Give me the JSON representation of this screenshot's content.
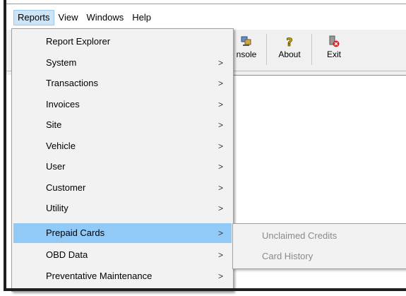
{
  "menubar": {
    "items": [
      {
        "label": "Reports",
        "active": true
      },
      {
        "label": "View",
        "active": false
      },
      {
        "label": "Windows",
        "active": false
      },
      {
        "label": "Help",
        "active": false
      }
    ]
  },
  "toolbar": {
    "buttons": [
      {
        "label": "nsole",
        "icon": "console-icon"
      },
      {
        "label": "About",
        "icon": "about-icon"
      },
      {
        "label": "Exit",
        "icon": "exit-icon"
      }
    ]
  },
  "reports_menu": {
    "items": [
      {
        "label": "Report Explorer",
        "has_submenu": false
      },
      {
        "label": "System",
        "has_submenu": true
      },
      {
        "label": "Transactions",
        "has_submenu": true
      },
      {
        "label": "Invoices",
        "has_submenu": true
      },
      {
        "label": "Site",
        "has_submenu": true
      },
      {
        "label": "Vehicle",
        "has_submenu": true
      },
      {
        "label": "User",
        "has_submenu": true
      },
      {
        "label": "Customer",
        "has_submenu": true
      },
      {
        "label": "Utility",
        "has_submenu": true
      },
      {
        "label": "Prepaid Cards",
        "has_submenu": true,
        "highlighted": true
      },
      {
        "label": "OBD Data",
        "has_submenu": true
      },
      {
        "label": "Preventative Maintenance",
        "has_submenu": true
      }
    ],
    "arrow_glyph": ">"
  },
  "prepaid_cards_submenu": {
    "items": [
      {
        "label": "Unclaimed Credits",
        "enabled": false
      },
      {
        "label": "Card History",
        "enabled": false
      }
    ]
  },
  "colors": {
    "highlight": "#91c9f7",
    "menu_active": "#cce4f7",
    "menu_bg": "#f2f2f2",
    "disabled_text": "#8a8a8a"
  }
}
